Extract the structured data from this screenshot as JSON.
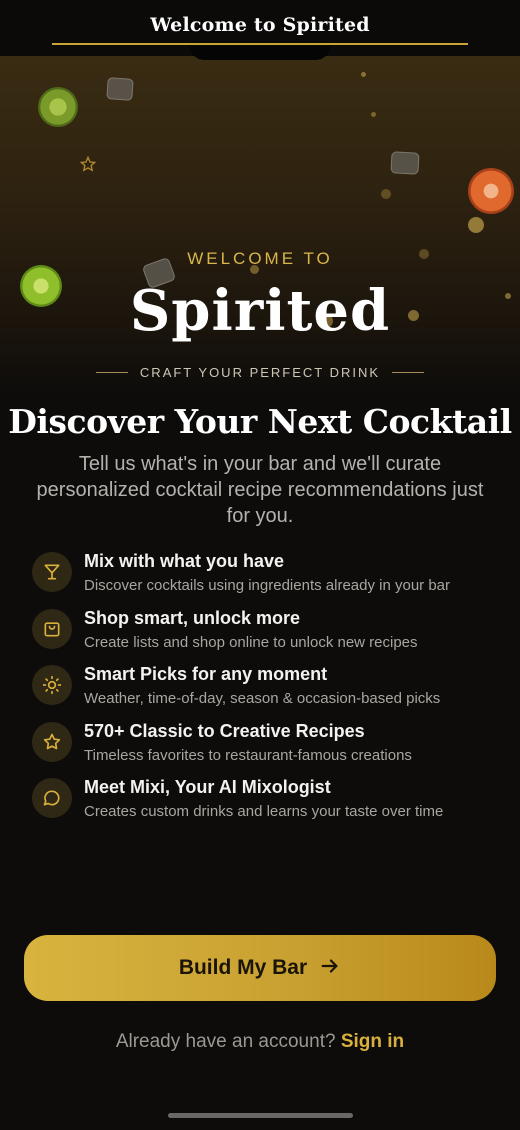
{
  "topbar": {
    "title": "Welcome to Spirited"
  },
  "hero": {
    "welcome_label": "WELCOME TO",
    "brand_name": "Spirited",
    "tagline": "CRAFT YOUR PERFECT DRINK"
  },
  "intro": {
    "headline": "Discover Your Next Cocktail",
    "subtext": "Tell us what's in your bar and we'll curate personalized cocktail recipe recommendations just for you."
  },
  "features": [
    {
      "icon": "cocktail-glass-icon",
      "title": "Mix with what you have",
      "desc": "Discover cocktails using ingredients already in your bar"
    },
    {
      "icon": "shopping-bag-icon",
      "title": "Shop smart, unlock more",
      "desc": "Create lists and shop online to unlock new recipes"
    },
    {
      "icon": "sun-icon",
      "title": "Smart Picks for any moment",
      "desc": "Weather, time-of-day, season & occasion-based picks"
    },
    {
      "icon": "star-icon",
      "title": "570+ Classic to Creative Recipes",
      "desc": "Timeless favorites to restaurant-famous creations"
    },
    {
      "icon": "chat-bubble-icon",
      "title": "Meet Mixi, Your AI Mixologist",
      "desc": "Creates custom drinks and learns your taste over time"
    }
  ],
  "cta": {
    "label": "Build My Bar",
    "icon": "arrow-right-icon"
  },
  "signin": {
    "prompt": "Already have an account?",
    "link": "Sign in"
  },
  "colors": {
    "accent": "#d9b03c",
    "background": "#0d0c0b",
    "cta_gradient_start": "#d8b43e",
    "cta_gradient_end": "#b8891a"
  }
}
